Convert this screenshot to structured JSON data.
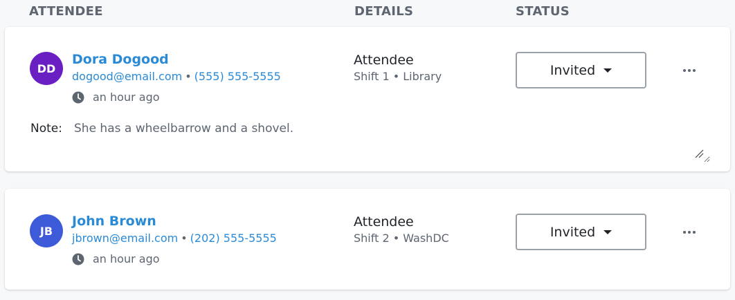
{
  "header": {
    "attendee": "ATTENDEE",
    "details": "DETAILS",
    "status": "STATUS"
  },
  "attendees": [
    {
      "initials": "DD",
      "avatar_color": "#6a1fc2",
      "name": "Dora Dogood",
      "email": "dogood@email.com",
      "separator": "•",
      "phone": "(555) 555-5555",
      "time": "an hour ago",
      "time_icon": "clock-icon",
      "role": "Attendee",
      "shift": "Shift 1 • Library",
      "status": "Invited",
      "note_label": "Note:",
      "note": "She has a wheelbarrow and a shovel."
    },
    {
      "initials": "JB",
      "avatar_color": "#3d5bd9",
      "name": "John Brown",
      "email": "jbrown@email.com",
      "separator": "•",
      "phone": "(202) 555-5555",
      "time": "an hour ago",
      "time_icon": "clock-icon",
      "role": "Attendee",
      "shift": "Shift 2 • WashDC",
      "status": "Invited"
    }
  ],
  "colors": {
    "link": "#2a8ad6",
    "muted": "#5c6570",
    "background": "#f7f8fa"
  }
}
